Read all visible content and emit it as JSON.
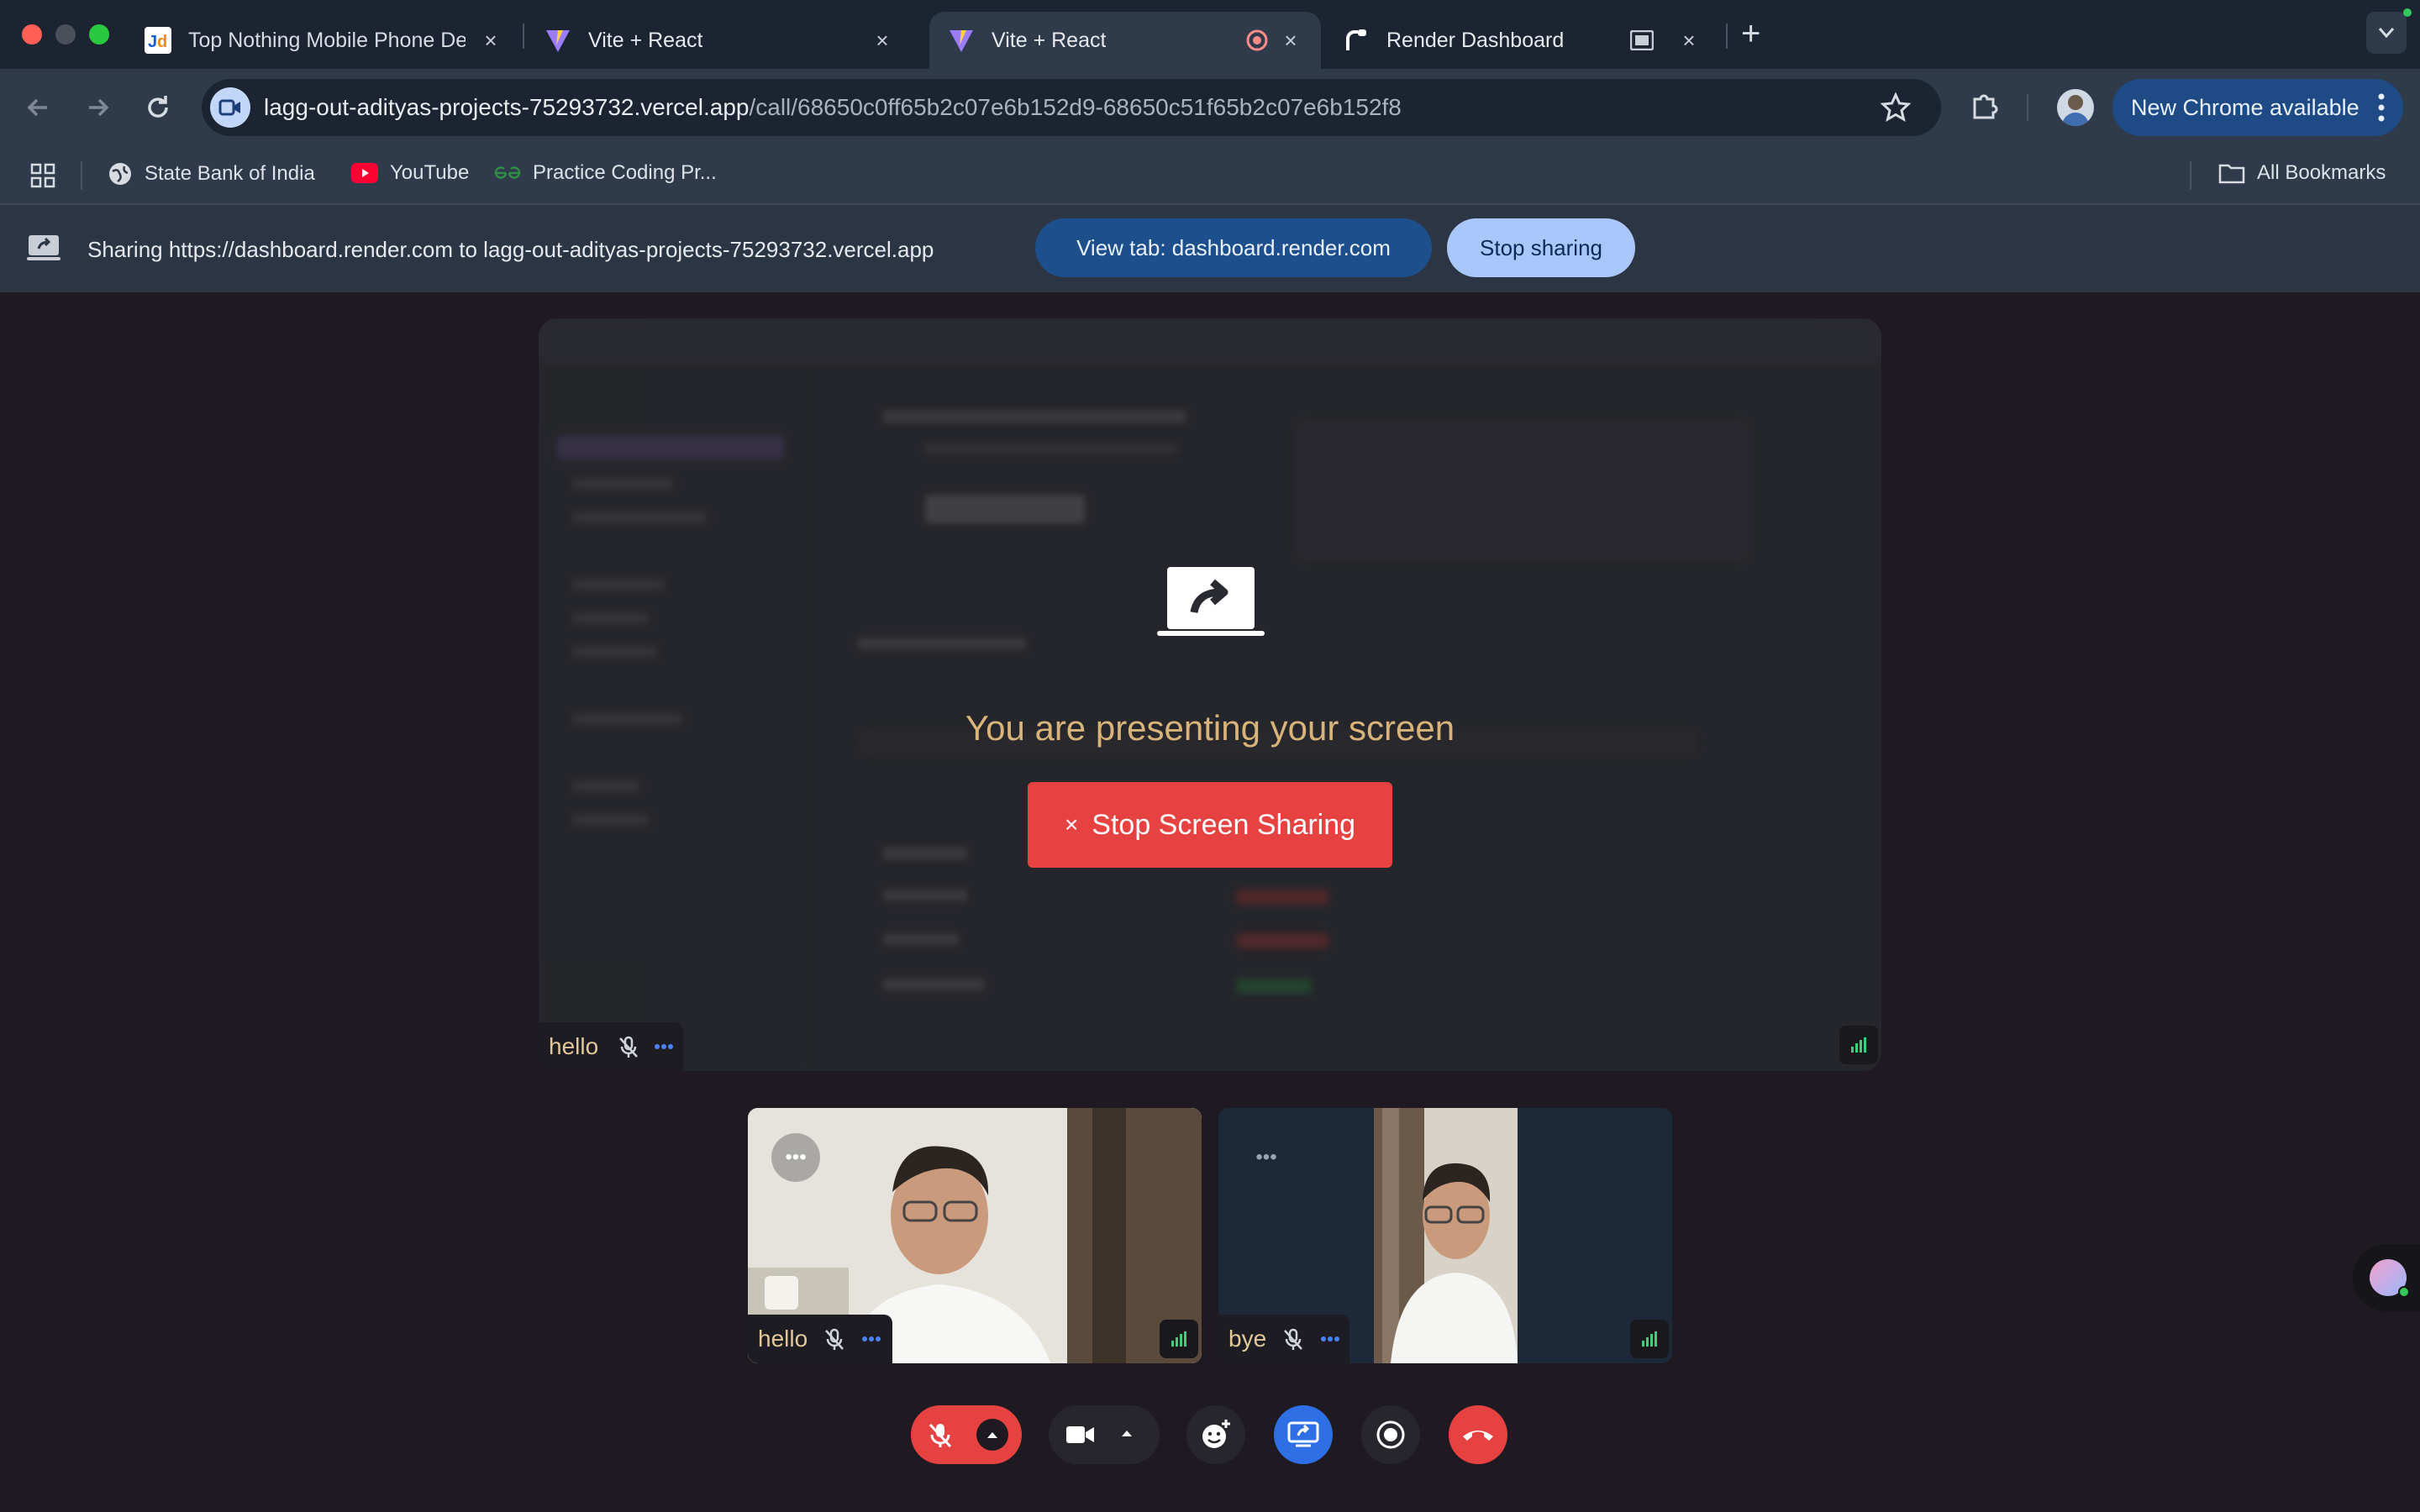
{
  "browser": {
    "tabs": [
      {
        "title": "Top Nothing Mobile Phone De",
        "favicon": "jd-icon",
        "active": false
      },
      {
        "title": "Vite + React",
        "favicon": "vite-icon",
        "active": false
      },
      {
        "title": "Vite + React",
        "favicon": "vite-icon",
        "active": true,
        "recording": true
      },
      {
        "title": "Render Dashboard",
        "favicon": "render-icon",
        "active": false,
        "sharing": true
      }
    ],
    "address": {
      "host": "lagg-out-adityas-projects-75293732.vercel.app",
      "path": "/call/68650c0ff65b2c07e6b152d9-68650c51f65b2c07e6b152f8"
    },
    "new_chrome_label": "New Chrome available",
    "bookmarks": [
      {
        "label": "State Bank of India",
        "icon": "globe-icon"
      },
      {
        "label": "YouTube",
        "icon": "youtube-icon"
      },
      {
        "label": "Practice Coding Pr...",
        "icon": "gfg-icon"
      }
    ],
    "all_bookmarks_label": "All Bookmarks"
  },
  "share_bar": {
    "text": "Sharing https://dashboard.render.com to lagg-out-adityas-projects-75293732.vercel.app",
    "view_tab_label": "View tab: dashboard.render.com",
    "stop_label": "Stop sharing"
  },
  "call": {
    "presenting_text": "You are presenting your screen",
    "stop_screen_label": "Stop Screen Sharing",
    "main_participant": "hello",
    "participants": [
      {
        "name": "hello",
        "muted": true
      },
      {
        "name": "bye",
        "muted": true
      }
    ],
    "colors": {
      "accent": "#2f6fe6",
      "danger": "#e64242",
      "name_text": "#e2c79a"
    }
  }
}
